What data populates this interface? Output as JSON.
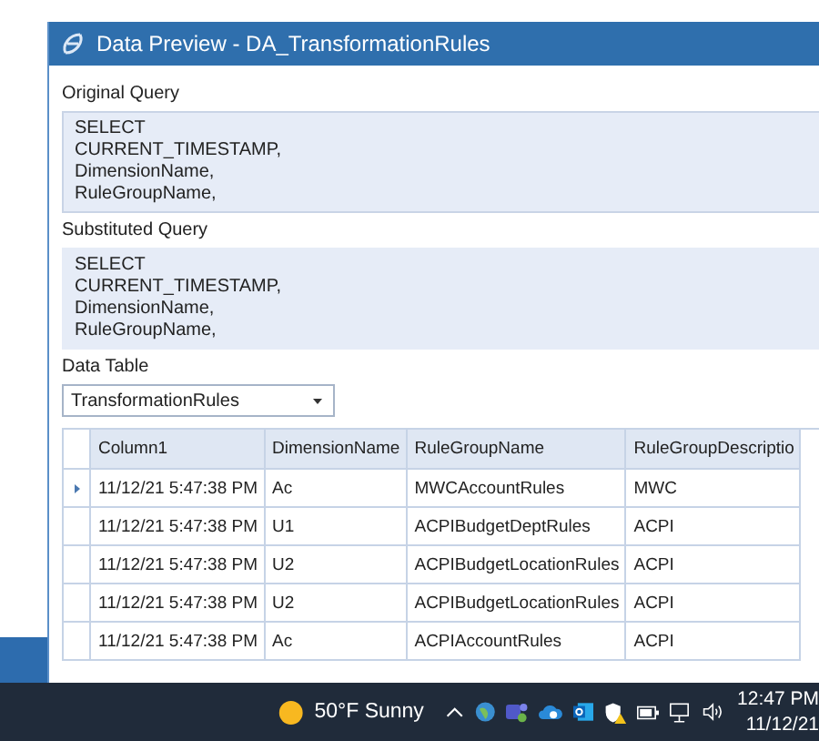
{
  "window": {
    "title": "Data Preview - DA_TransformationRules"
  },
  "original_query": {
    "label": "Original Query",
    "lines": [
      "SELECT",
      "CURRENT_TIMESTAMP,",
      "DimensionName,",
      "RuleGroupName,"
    ]
  },
  "substituted_query": {
    "label": "Substituted Query",
    "lines": [
      "SELECT",
      "CURRENT_TIMESTAMP,",
      "DimensionName,",
      "RuleGroupName,"
    ]
  },
  "data_table": {
    "label": "Data Table",
    "value": "TransformationRules"
  },
  "table": {
    "columns": [
      "Column1",
      "DimensionName",
      "RuleGroupName",
      "RuleGroupDescriptio"
    ],
    "rows": [
      {
        "selected": true,
        "cells": [
          "11/12/21 5:47:38 PM",
          "Ac",
          "MWCAccountRules",
          "MWC"
        ]
      },
      {
        "selected": false,
        "cells": [
          "11/12/21 5:47:38 PM",
          "U1",
          "ACPIBudgetDeptRules",
          "ACPI"
        ]
      },
      {
        "selected": false,
        "cells": [
          "11/12/21 5:47:38 PM",
          "U2",
          "ACPIBudgetLocationRules",
          "ACPI"
        ]
      },
      {
        "selected": false,
        "cells": [
          "11/12/21 5:47:38 PM",
          "U2",
          "ACPIBudgetLocationRules",
          "ACPI"
        ]
      },
      {
        "selected": false,
        "cells": [
          "11/12/21 5:47:38 PM",
          "Ac",
          "ACPIAccountRules",
          "ACPI"
        ]
      }
    ]
  },
  "taskbar": {
    "weather": "50°F  Sunny",
    "time": "12:47 PM",
    "date": "11/12/21"
  }
}
